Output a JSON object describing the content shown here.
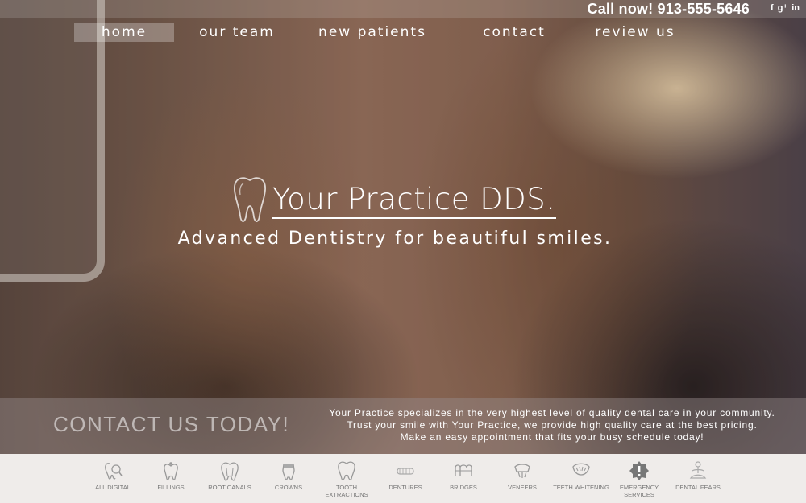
{
  "header": {
    "phone_text": "Call now! 913-555-5646",
    "social": [
      {
        "name": "facebook-icon",
        "glyph": "f"
      },
      {
        "name": "google-plus-icon",
        "glyph": "g⁺"
      },
      {
        "name": "linkedin-icon",
        "glyph": "in"
      }
    ]
  },
  "nav": {
    "items": [
      {
        "label": "home",
        "active": true
      },
      {
        "label": "our team",
        "active": false
      },
      {
        "label": "new patients",
        "active": false
      },
      {
        "label": "contact",
        "active": false
      },
      {
        "label": "review us",
        "active": false
      }
    ]
  },
  "hero": {
    "title": "Your Practice DDS.",
    "tagline": "Advanced Dentistry for beautiful smiles."
  },
  "contact": {
    "cta": "CONTACT US TODAY!",
    "lines": [
      "Your Practice specializes in the very highest level of quality dental care in your community.",
      "Trust your smile with Your Practice, we provide high quality care at the best pricing.",
      "Make an easy appointment that fits your busy schedule today!"
    ]
  },
  "services": [
    {
      "label": "ALL DIGITAL",
      "icon": "digital-tooth-icon"
    },
    {
      "label": "FILLINGS",
      "icon": "filling-icon"
    },
    {
      "label": "ROOT CANALS",
      "icon": "root-canal-icon"
    },
    {
      "label": "CROWNS",
      "icon": "crown-icon"
    },
    {
      "label": "TOOTH EXTRACTIONS",
      "icon": "tooth-extraction-icon"
    },
    {
      "label": "DENTURES",
      "icon": "dentures-icon"
    },
    {
      "label": "BRIDGES",
      "icon": "bridge-icon"
    },
    {
      "label": "VENEERS",
      "icon": "veneers-icon"
    },
    {
      "label": "TEETH WHITENING",
      "icon": "teeth-whitening-icon"
    },
    {
      "label": "EMERGENCY SERVICES",
      "icon": "emergency-icon"
    },
    {
      "label": "DENTAL FEARS",
      "icon": "dental-fears-icon"
    }
  ]
}
